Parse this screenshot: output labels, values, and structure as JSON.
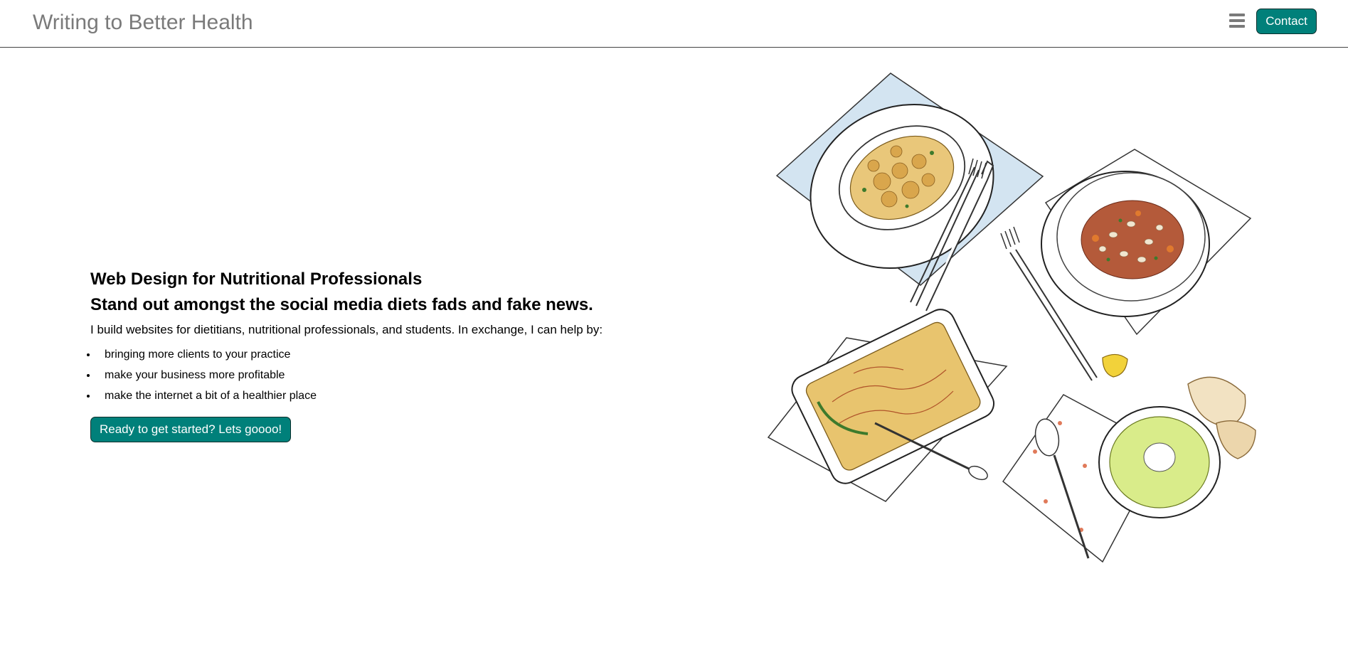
{
  "header": {
    "site_title": "Writing to Better Health",
    "menu_icon": "hamburger-menu-icon",
    "contact_label": "Contact"
  },
  "hero": {
    "heading": "Web Design for Nutritional Professionals",
    "subheading": "Stand out amongst the social media diets fads and fake news.",
    "intro": "I build websites for dietitians, nutritional professionals, and students. In exchange, I can help by:",
    "benefits": [
      "bringing more clients to your practice",
      "make your business more profitable",
      "make the internet a bit of a healthier place"
    ],
    "cta_label": "Ready to get started? Lets goooo!"
  },
  "colors": {
    "accent": "#00807a",
    "title_gray": "#7a7a7a"
  }
}
